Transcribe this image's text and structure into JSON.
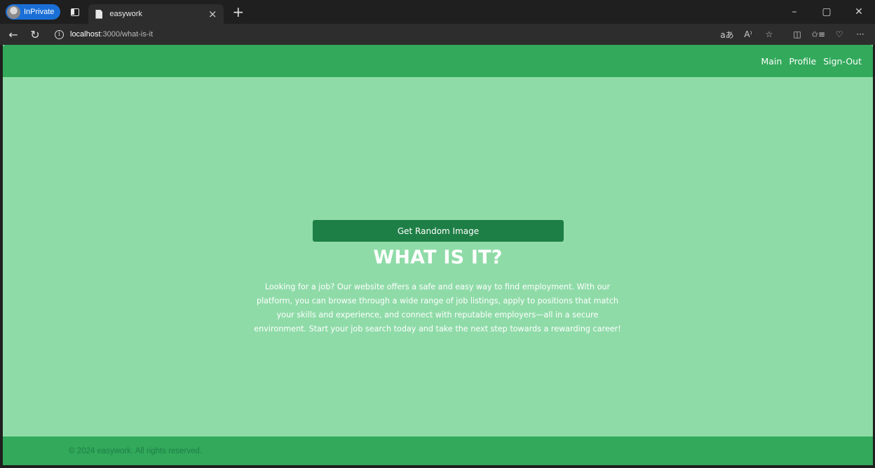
{
  "browser": {
    "profile_label": "InPrivate",
    "tab_title": "easywork",
    "tab_close_glyph": "×",
    "new_tab_glyph": "+",
    "window_controls": {
      "minimize": "–",
      "restore": "▢",
      "close": "✕"
    },
    "url_host": "localhost",
    "url_rest": ":3000/what-is-it",
    "icons": [
      "back-icon",
      "refresh-icon",
      "info-icon",
      "translate-icon",
      "read-aloud-icon",
      "favorite-icon",
      "split-screen-icon",
      "favorites-icon",
      "copilot-icon",
      "more-icon"
    ]
  },
  "header": {
    "nav": [
      "Main",
      "Profile",
      "Sign-Out"
    ]
  },
  "main": {
    "button_label": "Get Random Image",
    "heading": "WHAT IS IT?",
    "description": "Looking for a job? Our website offers a safe and easy way to find employment. With our platform, you can browse through a wide range of job listings, apply to positions that match your skills and experience, and connect with reputable employers—all in a secure environment. Start your job search today and take the next step towards a rewarding career!"
  },
  "footer": {
    "copyright": "© 2024 easywork. All rights reserved."
  },
  "colors": {
    "header_green": "#32a95b",
    "page_bg": "#8fdba8",
    "button_green": "#1e7f46"
  }
}
